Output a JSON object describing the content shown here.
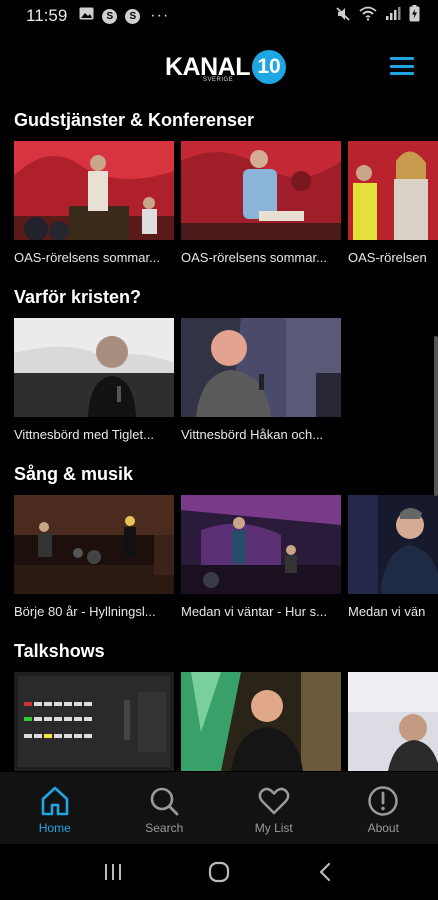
{
  "status_bar": {
    "time": "11:59",
    "left_icons": [
      "gallery-icon",
      "s-app-icon",
      "s-app-icon",
      "more-dots-icon"
    ],
    "right_icons": [
      "mute-icon",
      "wifi-icon",
      "signal-icon",
      "battery-icon"
    ],
    "s_icon_text": "S",
    "dots": "···"
  },
  "header": {
    "logo_text": "KANAL",
    "logo_number": "10",
    "logo_sub": "SVERIGE"
  },
  "sections": [
    {
      "title": "Gudstjänster & Konferenser",
      "items": [
        {
          "title": "OAS-rörelsens sommar..."
        },
        {
          "title": "OAS-rörelsens sommar..."
        },
        {
          "title": "OAS-rörelsen"
        }
      ]
    },
    {
      "title": "Varför kristen?",
      "items": [
        {
          "title": "Vittnesbörd med Tiglet..."
        },
        {
          "title": "Vittnesbörd Håkan och..."
        }
      ]
    },
    {
      "title": "Sång & musik",
      "items": [
        {
          "title": "Börje 80 år - Hyllningsl..."
        },
        {
          "title": "Medan vi väntar - Hur s..."
        },
        {
          "title": "Medan vi vän"
        }
      ]
    },
    {
      "title": "Talkshows",
      "items": [
        {
          "title": ""
        },
        {
          "title": ""
        },
        {
          "title": ""
        }
      ]
    }
  ],
  "bottom_nav": [
    {
      "label": "Home",
      "icon": "home-icon",
      "active": true
    },
    {
      "label": "Search",
      "icon": "search-icon",
      "active": false
    },
    {
      "label": "My List",
      "icon": "heart-icon",
      "active": false
    },
    {
      "label": "About",
      "icon": "info-icon",
      "active": false
    }
  ],
  "system_nav": [
    "recent-apps-icon",
    "home-circle-icon",
    "back-icon"
  ],
  "colors": {
    "accent": "#1ea6e3",
    "background": "#000000",
    "nav_background": "#121212",
    "inactive": "#9a9a9a"
  }
}
